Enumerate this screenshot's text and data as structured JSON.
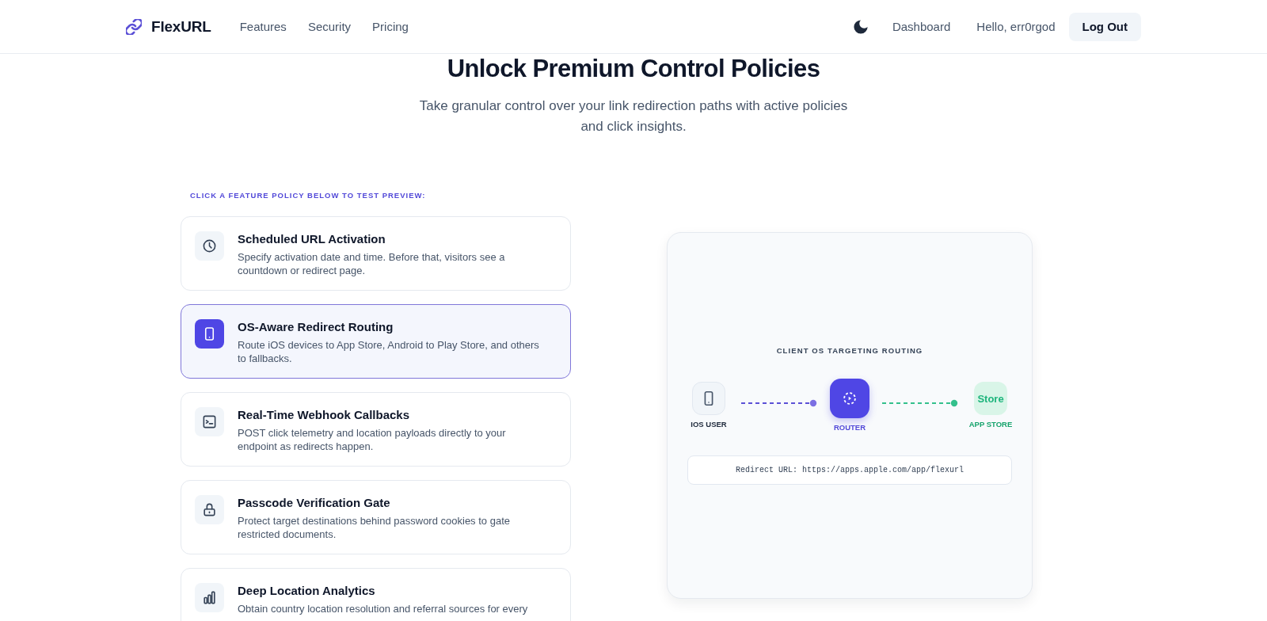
{
  "header": {
    "brand": "FlexURL",
    "links": [
      "Features",
      "Security",
      "Pricing"
    ],
    "dashboard": "Dashboard",
    "greeting": "Hello, err0rgod",
    "logout": "Log Out"
  },
  "hero": {
    "title": "Unlock Premium Control Policies",
    "subtitle": "Take granular control over your link redirection paths with active policies and click insights."
  },
  "features": {
    "prompt": "CLICK A FEATURE POLICY BELOW TO TEST PREVIEW:",
    "items": [
      {
        "title": "Scheduled URL Activation",
        "description": "Specify activation date and time. Before that, visitors see a countdown or redirect page.",
        "selected": false
      },
      {
        "title": "OS-Aware Redirect Routing",
        "description": "Route iOS devices to App Store, Android to Play Store, and others to fallbacks.",
        "selected": true
      },
      {
        "title": "Real-Time Webhook Callbacks",
        "description": "POST click telemetry and location payloads directly to your endpoint as redirects happen.",
        "selected": false
      },
      {
        "title": "Passcode Verification Gate",
        "description": "Protect target destinations behind password cookies to gate restricted documents.",
        "selected": false
      },
      {
        "title": "Deep Location Analytics",
        "description": "Obtain country location resolution and referral sources for every",
        "selected": false
      }
    ]
  },
  "preview": {
    "title": "CLIENT OS TARGETING ROUTING",
    "nodes": [
      {
        "kind": "device",
        "label": "IOS USER"
      },
      {
        "kind": "router",
        "label": "ROUTER"
      },
      {
        "kind": "store",
        "badge": "Store",
        "label": "APP STORE"
      }
    ],
    "redirect": "Redirect URL: https://apps.apple.com/app/flexurl"
  }
}
